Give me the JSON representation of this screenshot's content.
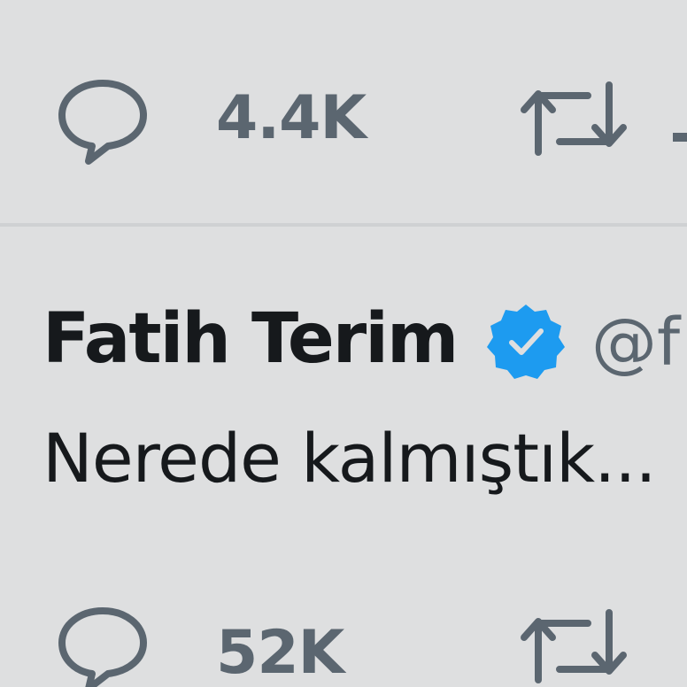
{
  "previous_tweet": {
    "reply_count": "4.4K"
  },
  "tweet": {
    "author_name": "Fatih Terim",
    "verified_icon": "verified-badge-icon",
    "handle": "@f",
    "text": "Nerede kalmıştık...",
    "reply_count": "52K"
  },
  "colors": {
    "background": "#dedfe0",
    "text_primary": "#16191c",
    "text_secondary": "#5b6670",
    "verified_blue": "#1d9bf0",
    "divider": "#cfd1d3"
  },
  "icons": {
    "reply": "speech-bubble-icon",
    "retweet": "retweet-arrows-icon"
  }
}
